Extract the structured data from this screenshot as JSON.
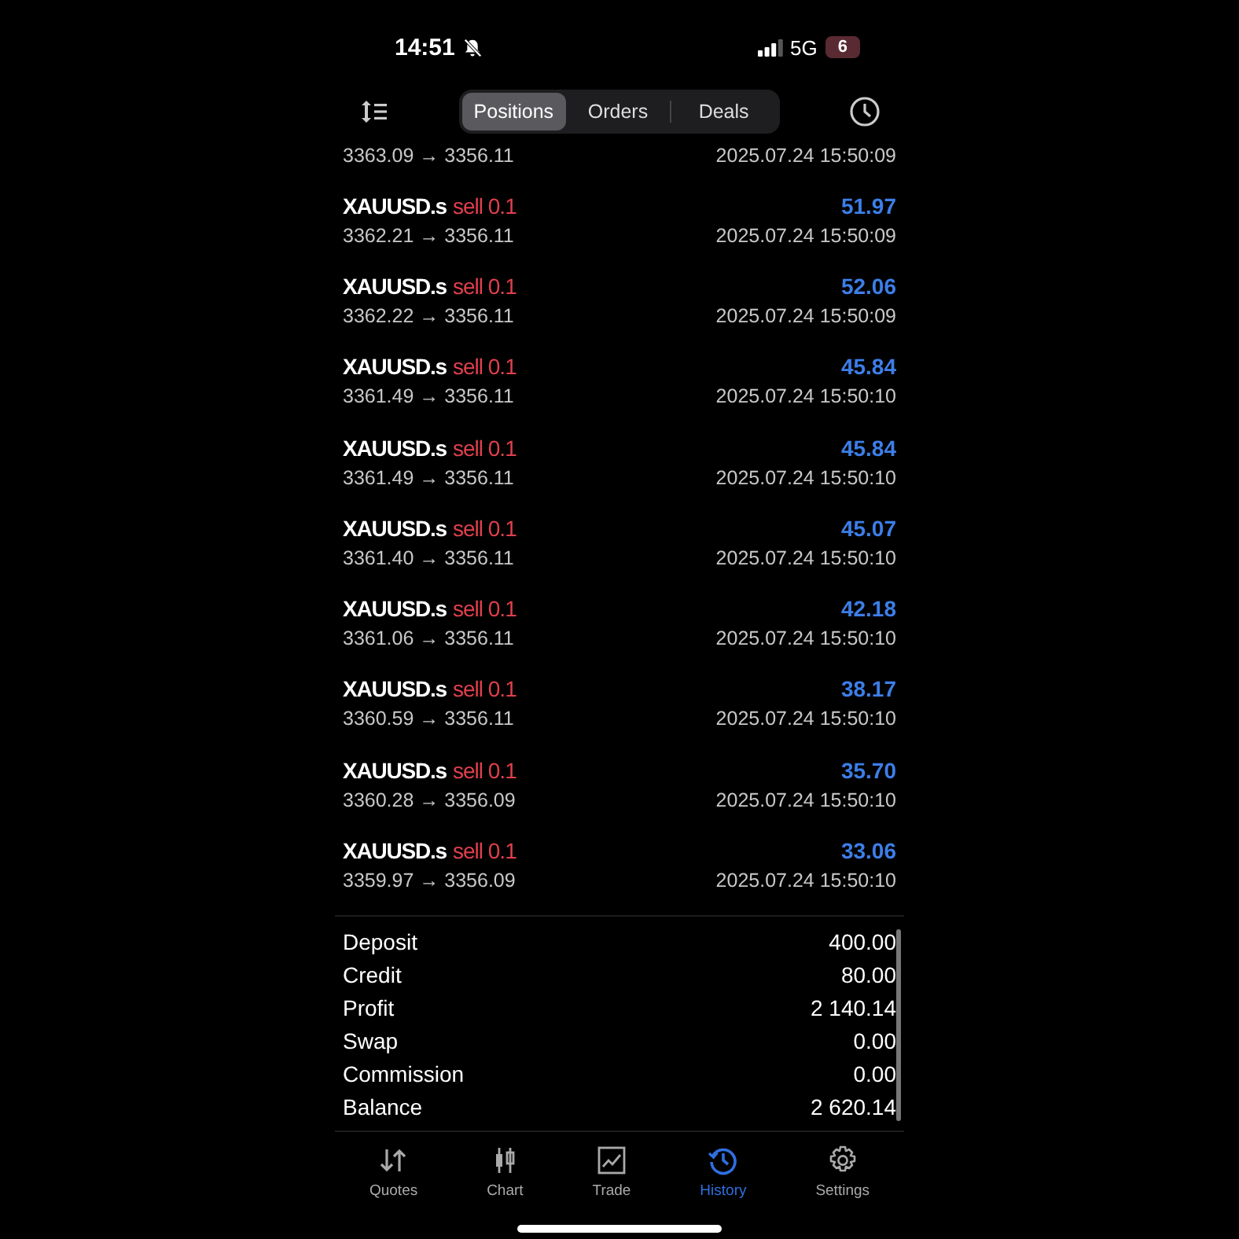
{
  "status_bar": {
    "time": "14:51",
    "network": "5G",
    "battery": "6"
  },
  "tabs": [
    {
      "label": "Positions",
      "selected": true
    },
    {
      "label": "Orders",
      "selected": false
    },
    {
      "label": "Deals",
      "selected": false
    }
  ],
  "partial_row": {
    "prices": "3363.09 → 3356.11",
    "time": "2025.07.24 15:50:09"
  },
  "deals": [
    {
      "symbol": "XAUUSD.s",
      "action": "sell 0.1",
      "profit": "51.97",
      "prices": "3362.21 → 3356.11",
      "time": "2025.07.24 15:50:09"
    },
    {
      "symbol": "XAUUSD.s",
      "action": "sell 0.1",
      "profit": "52.06",
      "prices": "3362.22 → 3356.11",
      "time": "2025.07.24 15:50:09"
    },
    {
      "symbol": "XAUUSD.s",
      "action": "sell 0.1",
      "profit": "45.84",
      "prices": "3361.49 → 3356.11",
      "time": "2025.07.24 15:50:10"
    },
    {
      "symbol": "XAUUSD.s",
      "action": "sell 0.1",
      "profit": "45.84",
      "prices": "3361.49 → 3356.11",
      "time": "2025.07.24 15:50:10"
    },
    {
      "symbol": "XAUUSD.s",
      "action": "sell 0.1",
      "profit": "45.07",
      "prices": "3361.40 → 3356.11",
      "time": "2025.07.24 15:50:10"
    },
    {
      "symbol": "XAUUSD.s",
      "action": "sell 0.1",
      "profit": "42.18",
      "prices": "3361.06 → 3356.11",
      "time": "2025.07.24 15:50:10"
    },
    {
      "symbol": "XAUUSD.s",
      "action": "sell 0.1",
      "profit": "38.17",
      "prices": "3360.59 → 3356.11",
      "time": "2025.07.24 15:50:10"
    },
    {
      "symbol": "XAUUSD.s",
      "action": "sell 0.1",
      "profit": "35.70",
      "prices": "3360.28 → 3356.09",
      "time": "2025.07.24 15:50:10"
    },
    {
      "symbol": "XAUUSD.s",
      "action": "sell 0.1",
      "profit": "33.06",
      "prices": "3359.97 → 3356.09",
      "time": "2025.07.24 15:50:10"
    }
  ],
  "summary": [
    {
      "label": "Deposit",
      "value": "400.00"
    },
    {
      "label": "Credit",
      "value": "80.00"
    },
    {
      "label": "Profit",
      "value": "2 140.14"
    },
    {
      "label": "Swap",
      "value": "0.00"
    },
    {
      "label": "Commission",
      "value": "0.00"
    },
    {
      "label": "Balance",
      "value": "2 620.14"
    }
  ],
  "nav": [
    {
      "label": "Quotes",
      "kind": "quotes",
      "selected": false
    },
    {
      "label": "Chart",
      "kind": "chart",
      "selected": false
    },
    {
      "label": "Trade",
      "kind": "trade",
      "selected": false
    },
    {
      "label": "History",
      "kind": "history",
      "selected": true
    },
    {
      "label": "Settings",
      "kind": "settings",
      "selected": false
    }
  ]
}
